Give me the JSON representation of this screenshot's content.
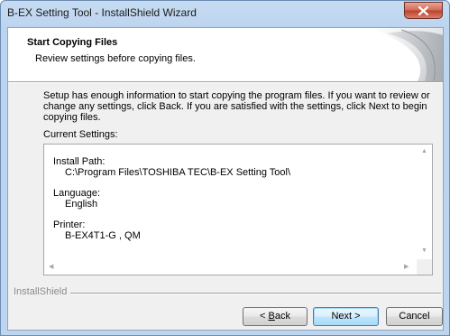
{
  "window": {
    "title": "B-EX Setting Tool - InstallShield Wizard"
  },
  "header": {
    "title": "Start Copying Files",
    "subtitle": "Review settings before copying files."
  },
  "body": {
    "description": "Setup has enough information to start copying the program files.  If you want to review or change any settings, click Back.  If you are satisfied with the settings, click Next to begin copying files.",
    "current_settings_label": "Current Settings:"
  },
  "settings": [
    {
      "label": "Install Path:",
      "value": "C:\\Program Files\\TOSHIBA TEC\\B-EX Setting Tool\\"
    },
    {
      "label": "Language:",
      "value": "English"
    },
    {
      "label": "Printer:",
      "value": "B-EX4T1-G , QM"
    }
  ],
  "footer": {
    "brand": "InstallShield"
  },
  "buttons": {
    "back_prefix": "< ",
    "back_key": "B",
    "back_rest": "ack",
    "next": "Next >",
    "cancel": "Cancel"
  },
  "icons": {
    "close": "close-icon",
    "scroll_up": "scroll-up-arrow-icon",
    "scroll_down": "scroll-down-arrow-icon",
    "scroll_left": "scroll-left-arrow-icon",
    "scroll_right": "scroll-right-arrow-icon"
  },
  "colors": {
    "frame": "#bcd4ef",
    "close_button": "#c0432c",
    "default_button_border": "#3c7fb1"
  }
}
